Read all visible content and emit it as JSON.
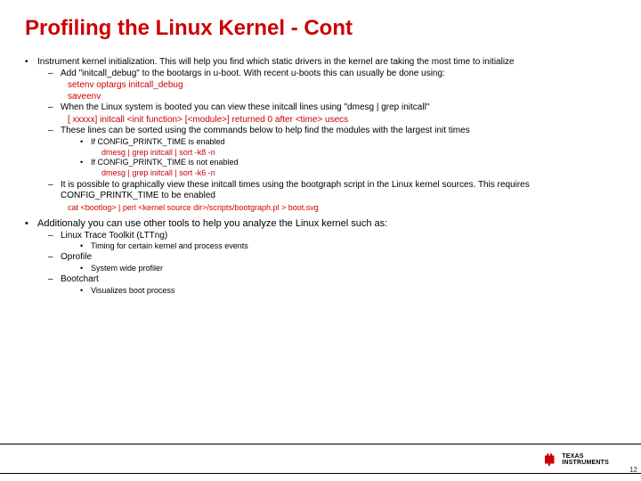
{
  "title": "Profiling the Linux Kernel - Cont",
  "b1": "Instrument kernel initialization. This will help you find which static drivers in the kernel are taking the most time to initialize",
  "b1a": "Add \"initcall_debug\" to the bootargs in u-boot. With recent u-boots this can usually be done using:",
  "b1a_code1": "setenv optargs initcall_debug",
  "b1a_code2": "saveenv",
  "b1b": "When the Linux system is booted you can view these initcall lines using \"dmesg | grep initcall\"",
  "b1b_code": "[   xxxxx] initcall <init function> [<module>] returned 0 after <time> usecs",
  "b1c": "These lines can be sorted using the commands below to help find the modules with the largest init times",
  "b1c1": "If CONFIG_PRINTK_TIME is enabled",
  "b1c1_code": "dmesg | grep initcall | sort -k8 -n",
  "b1c2": "If CONFIG_PRINTK_TIME is not enabled",
  "b1c2_code": "dmesg | grep initcall | sort -k6 -n",
  "b1d": "It is possible to graphically view these initcall times using the bootgraph script in the Linux kernel sources. This requires CONFIG_PRINTK_TIME to be enabled",
  "b1d_code": "cat <bootlog> | perl <kernel source dir>/scripts/bootgraph.pl > boot.svg",
  "b2": "Additionaly you can use other tools to help you analyze the Linux kernel such as:",
  "b2a": "Linux Trace Toolkit (LTTng)",
  "b2a1": "Timing for certain kernel and process events",
  "b2b": "Oprofile",
  "b2b1": "System wide profiler",
  "b2c": "Bootchart",
  "b2c1": "Visualizes boot process",
  "logo_line1": "TEXAS",
  "logo_line2": "INSTRUMENTS",
  "page": "12"
}
